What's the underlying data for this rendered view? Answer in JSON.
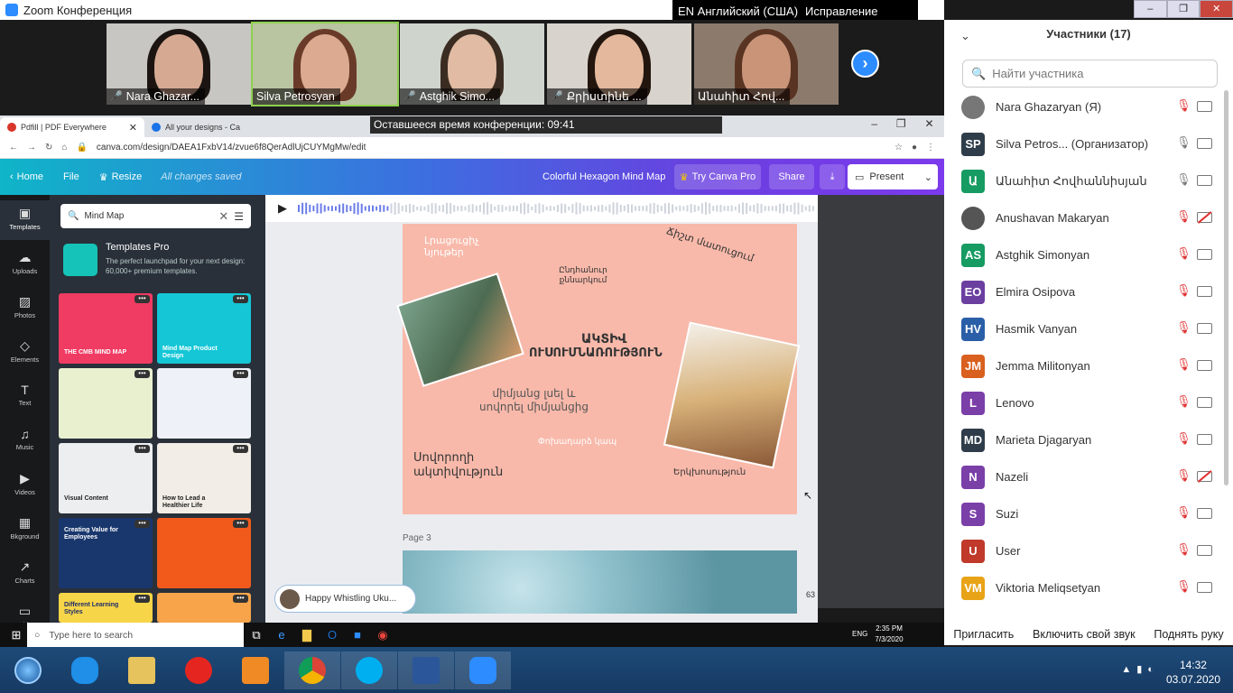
{
  "zoom": {
    "window_title": "Zoom Конференция",
    "language": "EN Английский (США)",
    "correction": "Исправление",
    "timer": "Оставшееся время конференции: 09:41",
    "videos": [
      {
        "name": "Nara Ghazar...",
        "muted": true,
        "bg": "#c7c6c2",
        "hair": "#1b1410",
        "skin": "#d6a993"
      },
      {
        "name": "Silva Petrosyan",
        "muted": false,
        "bg": "#b9c4a0",
        "hair": "#6a3a28",
        "skin": "#dcaa90"
      },
      {
        "name": "Astghik Simo...",
        "muted": true,
        "bg": "#cfd5cd",
        "hair": "#3b2c22",
        "skin": "#e1bba3"
      },
      {
        "name": "Քրիստինե ...",
        "muted": true,
        "bg": "#d8d3cc",
        "hair": "#22160f",
        "skin": "#e3b89c"
      },
      {
        "name": "Անահիտ Հով...",
        "muted": false,
        "bg": "#8c7b6c",
        "hair": "#5a3422",
        "skin": "#c99478"
      }
    ]
  },
  "browser": {
    "tabs": [
      {
        "label": "Pdfill | PDF Everywhere",
        "color": "#d9352b",
        "active": true
      },
      {
        "label": "All your designs - Ca",
        "color": "#1a73e8",
        "active": false
      }
    ],
    "url": "canva.com/design/DAEA1FxbV14/zvue6f8QerAdlUjCUYMgMw/edit"
  },
  "canva": {
    "home": "Home",
    "file": "File",
    "resize": "Resize",
    "saved": "All changes saved",
    "doc_title": "Colorful Hexagon Mind Map",
    "try_pro": "Try Canva Pro",
    "share": "Share",
    "present": "Present",
    "rail": [
      "Templates",
      "Uploads",
      "Photos",
      "Elements",
      "Text",
      "Music",
      "Videos",
      "Bkground",
      "Charts",
      "Folder"
    ],
    "search_value": "Mind Map",
    "templates_pro_title": "Templates Pro",
    "templates_pro_desc": "The perfect launchpad for your next design: 60,000+ premium templates.",
    "thumb_labels": [
      "THE CMB MIND MAP",
      "Mind Map Product Design",
      "",
      "",
      "Visual Content",
      "How to Lead a Healthier Life",
      "Creating Value for Employees",
      "",
      "Different Learning Styles",
      ""
    ],
    "slide": {
      "center_line1": "ԱԿՏԻՎ",
      "center_line2": "ՈՒՍՈՒՄՆԱՌՈՒԹՅՈՒՆ",
      "t1": "Լրացուցիչ նյութեր",
      "t2": "Ընդհանուր քննարկում",
      "t3": "Ճիշտ մատուցում",
      "t4": "միմյանց լսել և սովորել միմյանցից",
      "t5": "Փոխադարձ կապ",
      "t6": "Սովորողի ակտիվություն",
      "t7": "Երկխոսություն"
    },
    "page_label": "Page 3",
    "music": "Happy Whistling Uku...",
    "zoom_level": "63"
  },
  "participants": {
    "title": "Участники (17)",
    "search_placeholder": "Найти участника",
    "list": [
      {
        "initials": "",
        "name": "Nara Ghazaryan (Я)",
        "color": "#777",
        "mic": "off",
        "cam": "on"
      },
      {
        "initials": "SP",
        "name": "Silva Petros...   (Организатор)",
        "color": "#2f3d4a",
        "mic": "on",
        "cam": "on"
      },
      {
        "initials": "Ա",
        "name": "Անահիտ Հովհաննիսյան",
        "color": "#169b62",
        "mic": "on",
        "cam": "on"
      },
      {
        "initials": "",
        "name": "Anushavan Makaryan",
        "color": "#555",
        "mic": "off",
        "cam": "off"
      },
      {
        "initials": "AS",
        "name": "Astghik Simonyan",
        "color": "#169b62",
        "mic": "off",
        "cam": "on"
      },
      {
        "initials": "EO",
        "name": "Elmira Osipova",
        "color": "#6b3fa0",
        "mic": "off",
        "cam": "on"
      },
      {
        "initials": "HV",
        "name": "Hasmik Vanyan",
        "color": "#2a5fa8",
        "mic": "off",
        "cam": "on"
      },
      {
        "initials": "JM",
        "name": "Jemma Militonyan",
        "color": "#d9601f",
        "mic": "off",
        "cam": "on"
      },
      {
        "initials": "L",
        "name": "Lenovo",
        "color": "#7b3fa8",
        "mic": "off",
        "cam": "on"
      },
      {
        "initials": "MD",
        "name": "Marieta Djagaryan",
        "color": "#2f3d4a",
        "mic": "off",
        "cam": "on"
      },
      {
        "initials": "N",
        "name": "Nazeli",
        "color": "#7b3fa8",
        "mic": "off",
        "cam": "off"
      },
      {
        "initials": "S",
        "name": "Suzi",
        "color": "#7b3fa8",
        "mic": "off",
        "cam": "on"
      },
      {
        "initials": "U",
        "name": "User",
        "color": "#c0392b",
        "mic": "off",
        "cam": "on"
      },
      {
        "initials": "VM",
        "name": "Viktoria Meliqsetyan",
        "color": "#e8a317",
        "mic": "off",
        "cam": "on"
      }
    ],
    "invite": "Пригласить",
    "unmute": "Включить свой звук",
    "raise_hand": "Поднять руку"
  },
  "taskbar_inner": {
    "search": "Type here to search",
    "lang": "ENG",
    "time": "2:35 PM",
    "date": "7/3/2020"
  },
  "taskbar_outer": {
    "time": "14:32",
    "date": "03.07.2020"
  }
}
